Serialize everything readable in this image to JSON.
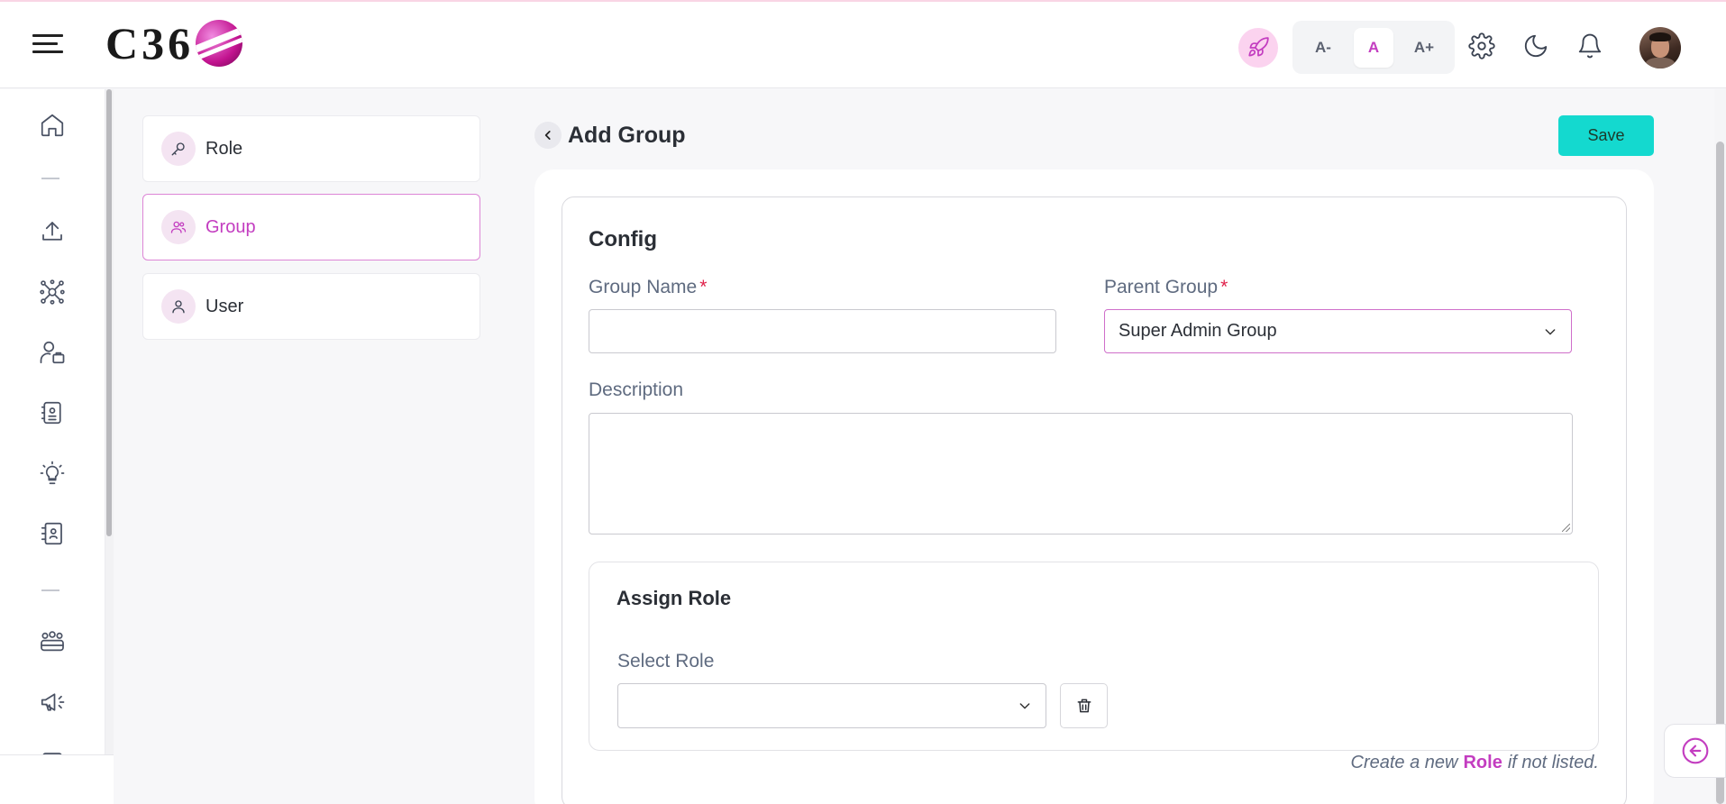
{
  "header": {
    "logo_text": "C36",
    "font_small": "A-",
    "font_normal": "A",
    "font_large": "A+"
  },
  "subnav": {
    "items": [
      {
        "label": "Role",
        "icon": "key-icon"
      },
      {
        "label": "Group",
        "icon": "users-icon",
        "active": true
      },
      {
        "label": "User",
        "icon": "user-icon"
      }
    ]
  },
  "page": {
    "title": "Add Group",
    "save_label": "Save"
  },
  "config": {
    "title": "Config",
    "group_name_label": "Group Name",
    "group_name_value": "",
    "parent_group_label": "Parent Group",
    "parent_group_value": "Super Admin Group",
    "required_mark": "*",
    "description_label": "Description",
    "description_value": ""
  },
  "assign_role": {
    "title": "Assign Role",
    "select_label": "Select Role",
    "select_value": "",
    "hint_prefix": "Create a new",
    "hint_link": "Role",
    "hint_suffix": "if not listed."
  },
  "colors": {
    "accent": "#c33dc0",
    "save_button": "#14d9cf",
    "required": "#e0224b",
    "label": "#5f6b80"
  }
}
